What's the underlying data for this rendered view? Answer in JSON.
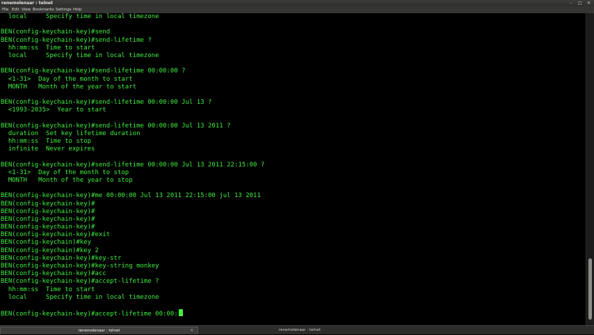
{
  "window": {
    "title": "renemolenaar : telnet",
    "controls": [
      "close-icon",
      "maximize-icon",
      "minimize-icon"
    ]
  },
  "menu": [
    "File",
    "Edit",
    "View",
    "Bookmarks",
    "Settings",
    "Help"
  ],
  "terminal": {
    "lines": [
      "  local     Specify time in local timezone",
      "",
      "BEN(config-keychain-key)#send",
      "BEN(config-keychain-key)#send-lifetime ?",
      "  hh:mm:ss  Time to start",
      "  local     Specify time in local timezone",
      "",
      "BEN(config-keychain-key)#send-lifetime 00:00:00 ?",
      "  <1-31>  Day of the month to start",
      "  MONTH   Month of the year to start",
      "",
      "BEN(config-keychain-key)#send-lifetime 00:00:00 Jul 13 ?",
      "  <1993-2035>  Year to start",
      "",
      "BEN(config-keychain-key)#send-lifetime 00:00:00 Jul 13 2011 ?",
      "  duration  Set key lifetime duration",
      "  hh:mm:ss  Time to stop",
      "  infinite  Never expires",
      "",
      "BEN(config-keychain-key)#send-lifetime 00:00:00 Jul 13 2011 22:15:00 ?",
      "  <1-31>  Day of the month to stop",
      "  MONTH   Month of the year to stop",
      "",
      "BEN(config-keychain-key)#me 00:00:00 Jul 13 2011 22:15:00 jul 13 2011",
      "BEN(config-keychain-key)#",
      "BEN(config-keychain-key)#",
      "BEN(config-keychain-key)#",
      "BEN(config-keychain-key)#",
      "BEN(config-keychain-key)#exit",
      "BEN(config-keychain)#key",
      "BEN(config-keychain)#key 2",
      "BEN(config-keychain-key)#key-str",
      "BEN(config-keychain-key)#key-string monkey",
      "BEN(config-keychain-key)#acc",
      "BEN(config-keychain-key)#accept-lifetime ?",
      "  hh:mm:ss  Time to start",
      "  local     Specify time in local timezone",
      ""
    ],
    "prompt_line": "BEN(config-keychain-key)#accept-lifetime 00:00:",
    "text_color": "#41ef41",
    "background_color": "#000000"
  },
  "tabs": [
    {
      "label": "renemolenaar : telnet",
      "close_icon": "close-icon",
      "active": true
    },
    {
      "label": "renemolenaar : telnet",
      "active": false
    }
  ]
}
